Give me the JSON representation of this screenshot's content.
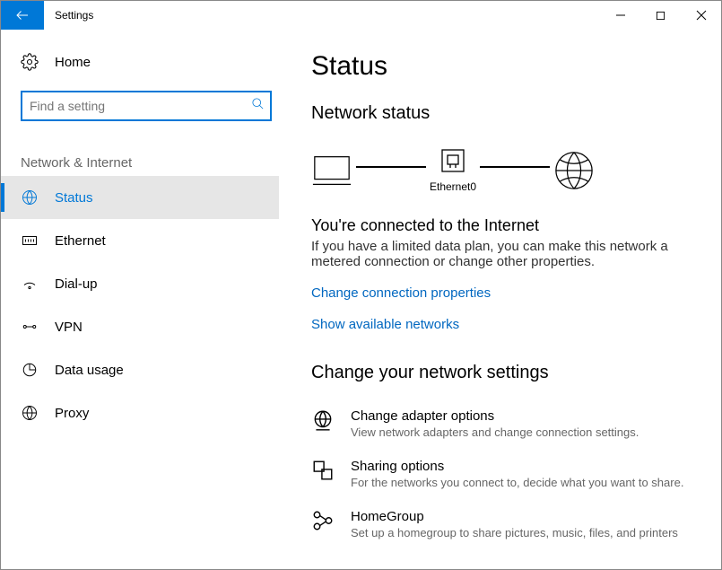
{
  "titlebar": {
    "title": "Settings"
  },
  "sidebar": {
    "home_label": "Home",
    "search_placeholder": "Find a setting",
    "group_label": "Network & Internet",
    "items": [
      {
        "label": "Status"
      },
      {
        "label": "Ethernet"
      },
      {
        "label": "Dial-up"
      },
      {
        "label": "VPN"
      },
      {
        "label": "Data usage"
      },
      {
        "label": "Proxy"
      }
    ]
  },
  "main": {
    "heading": "Status",
    "section1_heading": "Network status",
    "diagram_label": "Ethernet0",
    "connected_title": "You're connected to the Internet",
    "connected_desc": "If you have a limited data plan, you can make this network a metered connection or change other properties.",
    "link_props": "Change connection properties",
    "link_nets": "Show available networks",
    "section2_heading": "Change your network settings",
    "settings": [
      {
        "title": "Change adapter options",
        "desc": "View network adapters and change connection settings."
      },
      {
        "title": "Sharing options",
        "desc": "For the networks you connect to, decide what you want to share."
      },
      {
        "title": "HomeGroup",
        "desc": "Set up a homegroup to share pictures, music, files, and printers"
      }
    ]
  }
}
